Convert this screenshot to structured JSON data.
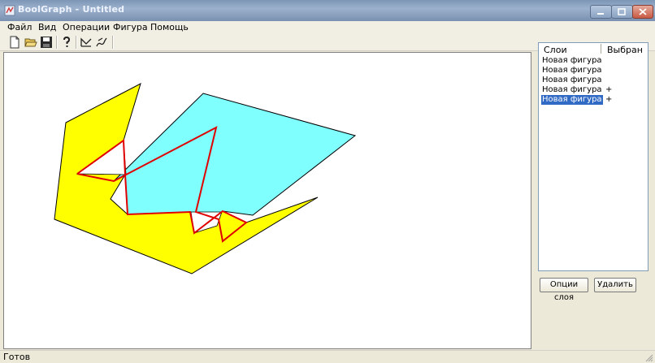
{
  "window": {
    "title": "BoolGraph - Untitled"
  },
  "menu": {
    "items": [
      "Файл",
      "Вид",
      "Операции",
      "Фигура",
      "Помощь"
    ]
  },
  "toolbar": {
    "buttons": [
      "new-file-icon",
      "open-folder-icon",
      "save-icon",
      "help-icon",
      "polyline-tool-icon",
      "freehand-tool-icon"
    ]
  },
  "canvas": {
    "colors": {
      "cyan": "#80ffff",
      "yellow": "#ffff00",
      "outline": "#e00000",
      "stroke": "#000000"
    }
  },
  "layers_panel": {
    "col_layers": "Слои",
    "col_selected": "Выбран",
    "rows": [
      {
        "label": "Новая фигура",
        "mark": "",
        "selected": false
      },
      {
        "label": "Новая фигура",
        "mark": "",
        "selected": false
      },
      {
        "label": "Новая фигура",
        "mark": "",
        "selected": false
      },
      {
        "label": "Новая фигура",
        "mark": "+",
        "selected": false
      },
      {
        "label": "Новая фигура",
        "mark": "+",
        "selected": true
      }
    ],
    "options_button": "Опции слоя",
    "delete_button": "Удалить"
  },
  "status": {
    "text": "Готов"
  },
  "colors": {
    "selection": "#316ac5",
    "titlebar": "#9cb1cc",
    "face": "#ece9d8"
  }
}
